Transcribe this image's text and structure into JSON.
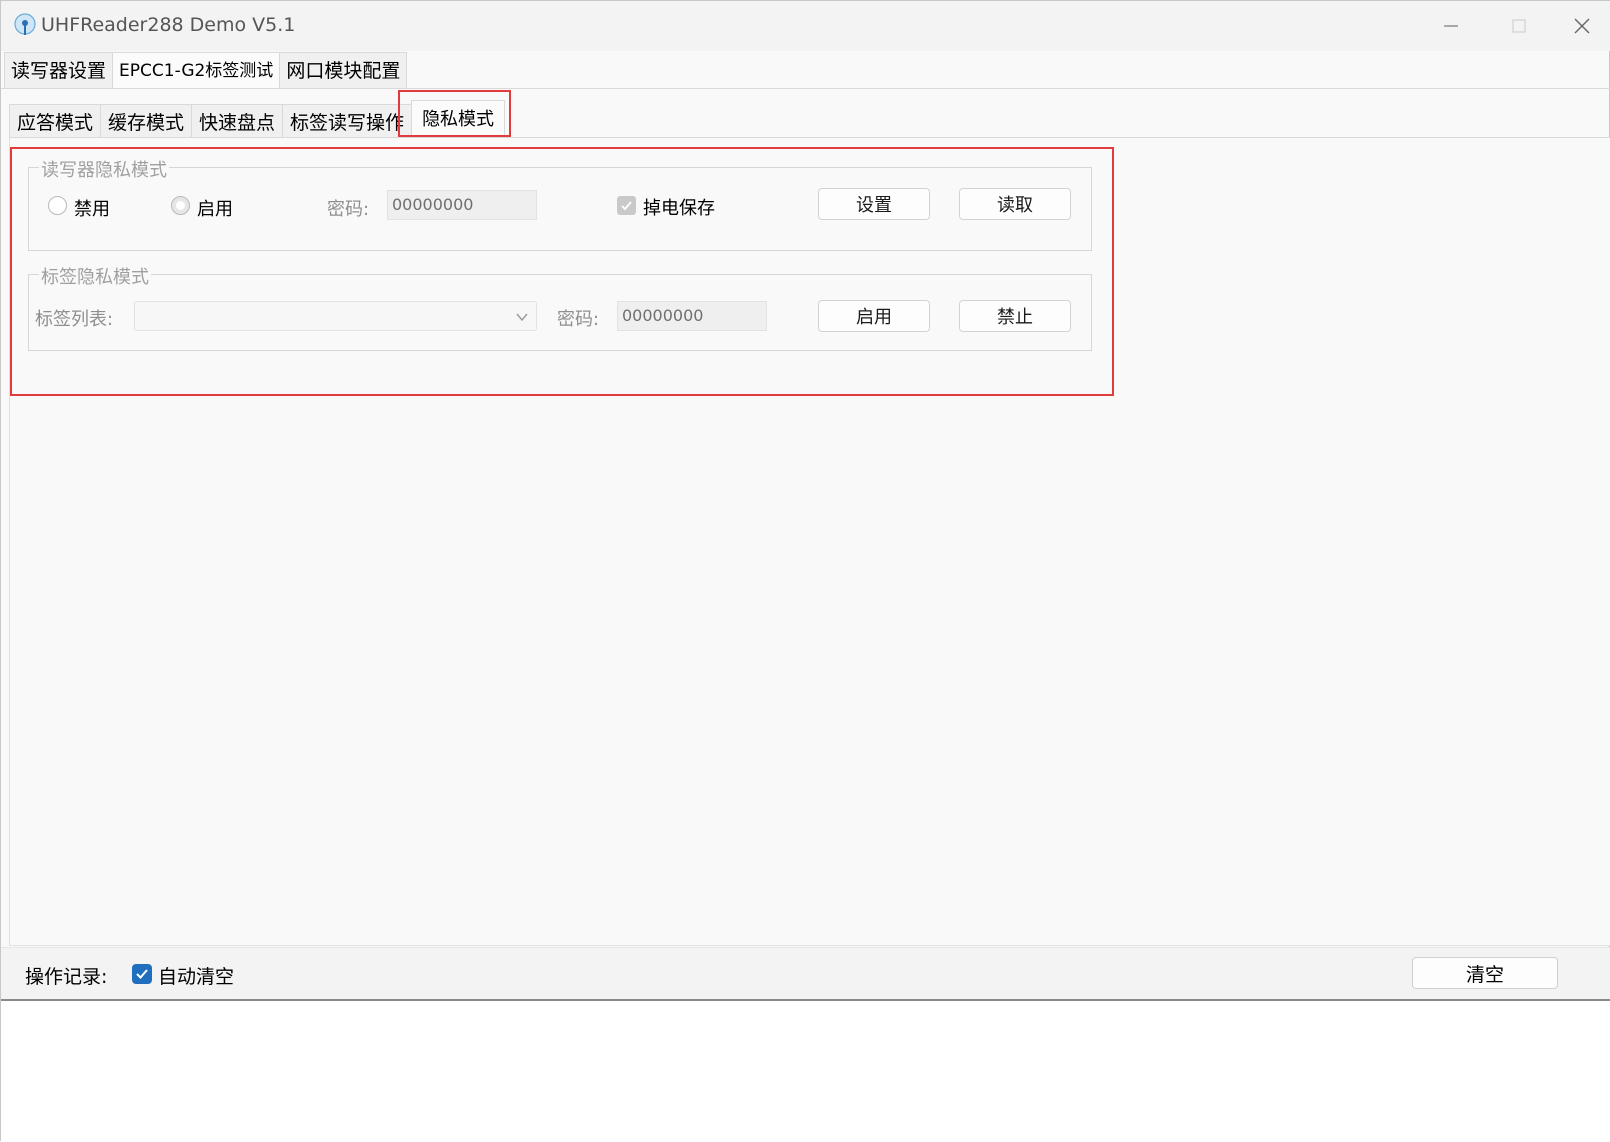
{
  "window": {
    "title": "UHFReader288 Demo V5.1"
  },
  "outer_tabs": [
    {
      "label": "读写器设置"
    },
    {
      "label": "EPCC1-G2标签测试"
    },
    {
      "label": "网口模块配置"
    }
  ],
  "inner_tabs": [
    {
      "label": "应答模式"
    },
    {
      "label": "缓存模式"
    },
    {
      "label": "快速盘点"
    },
    {
      "label": "标签读写操作"
    },
    {
      "label": "隐私模式"
    }
  ],
  "reader_privacy": {
    "legend": "读写器隐私模式",
    "disable_label": "禁用",
    "enable_label": "启用",
    "selected": "enable",
    "password_label": "密码:",
    "password_value": "00000000",
    "power_save_label": "掉电保存",
    "power_save_checked": true,
    "set_button": "设置",
    "read_button": "读取"
  },
  "tag_privacy": {
    "legend": "标签隐私模式",
    "tag_list_label": "标签列表:",
    "tag_list_value": "",
    "password_label": "密码:",
    "password_value": "00000000",
    "enable_button": "启用",
    "disable_button": "禁止"
  },
  "log": {
    "label": "操作记录:",
    "auto_clear_label": "自动清空",
    "auto_clear_checked": true,
    "clear_button": "清空",
    "content": ""
  },
  "colors": {
    "highlight": "#e03c3c",
    "checkbox_accent": "#1f6fbe"
  }
}
